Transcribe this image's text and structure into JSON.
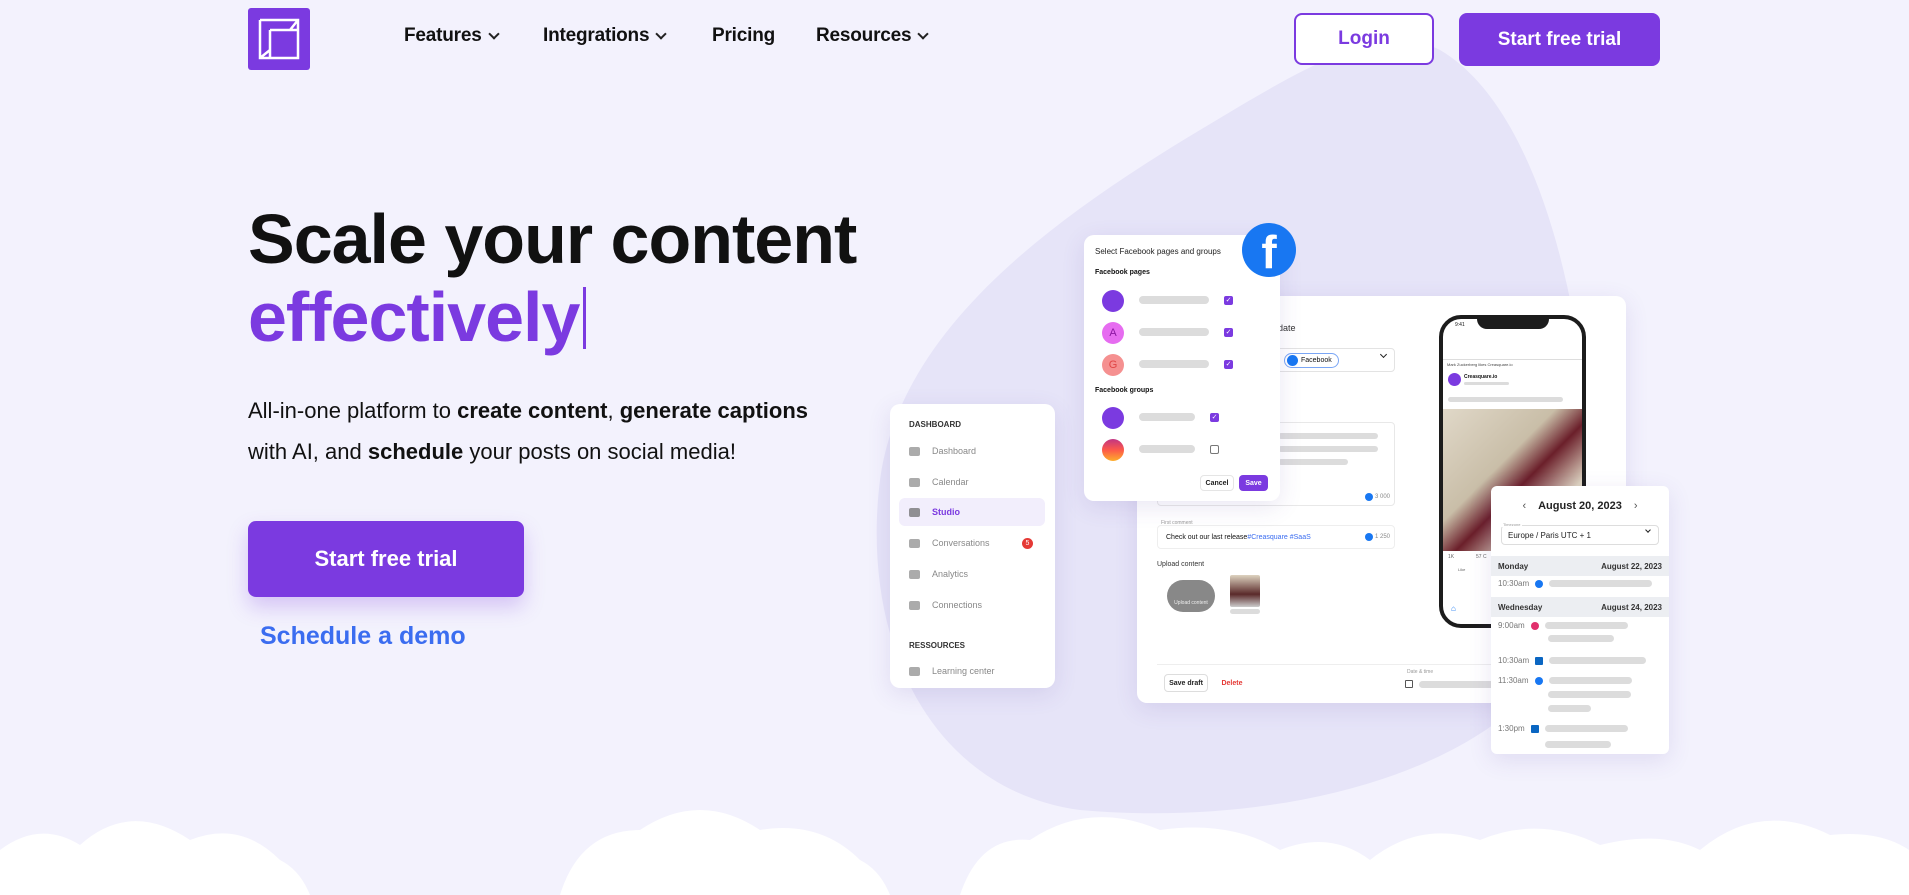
{
  "nav": {
    "items": [
      {
        "label": "Features",
        "dropdown": true
      },
      {
        "label": "Integrations",
        "dropdown": true
      },
      {
        "label": "Pricing",
        "dropdown": false
      },
      {
        "label": "Resources",
        "dropdown": true
      }
    ],
    "login": "Login",
    "start_trial": "Start free trial"
  },
  "hero": {
    "title_line1": "Scale your content",
    "title_line2": "effectively",
    "para": {
      "p1": "All-in-one platform to ",
      "b1": "create content",
      ",": ", ",
      "b2": "generate captions",
      "p2": "with AI, and ",
      "b3": "schedule",
      "p3": " your posts on social media!"
    },
    "cta": "Start free trial",
    "demo": "Schedule a demo"
  },
  "colors": {
    "brand": "#7b3ae0",
    "link": "#3b6df0",
    "background": "#f3f2fd",
    "facebook": "#1877f2"
  },
  "sidebar": {
    "section1": "DASHBOARD",
    "items": [
      {
        "label": "Dashboard",
        "icon": "gauge-icon"
      },
      {
        "label": "Calendar",
        "icon": "calendar-icon"
      },
      {
        "label": "Studio",
        "icon": "video-icon",
        "active": true
      },
      {
        "label": "Conversations",
        "icon": "chat-icon",
        "badge": "5"
      },
      {
        "label": "Analytics",
        "icon": "chart-icon"
      },
      {
        "label": "Connections",
        "icon": "sliders-icon"
      }
    ],
    "section2": "RESSOURCES",
    "items2": [
      {
        "label": "Learning center",
        "icon": "shapes-icon"
      }
    ]
  },
  "popup": {
    "title": "Select Facebook pages and groups",
    "pages_label": "Facebook pages",
    "groups_label": "Facebook groups",
    "pages": [
      {
        "avatar": "logo",
        "checked": true
      },
      {
        "avatar": "A",
        "checked": true
      },
      {
        "avatar": "G",
        "checked": true
      }
    ],
    "groups": [
      {
        "avatar": "logo",
        "checked": true
      },
      {
        "avatar": "instagram",
        "checked": false
      }
    ],
    "cancel": "Cancel",
    "save": "Save"
  },
  "studio": {
    "date_label": "date",
    "channel_chip": "Facebook",
    "counter1": "3 000",
    "first_comment_label": "First comment",
    "first_comment": "Check out our last release ",
    "hashtags": "#Creasquare #SaaS",
    "counter2": "1 250",
    "upload_label": "Upload content",
    "upload_button": "Upload content",
    "save_draft": "Save draft",
    "delete": "Delete",
    "date_time_label": "Date & time"
  },
  "phone": {
    "time": "9:41",
    "post_header": "Mark Zuckerberg likes Creasquare.io",
    "page_name": "Creasquare.io",
    "reactions": "1K",
    "comments": "57 C",
    "like": "Like"
  },
  "calendar": {
    "date": "August 20, 2023",
    "timezone_label": "Timezone",
    "timezone": "Europe / Paris UTC + 1",
    "days": [
      {
        "day": "Monday",
        "date": "August 22, 2023",
        "slots": [
          {
            "time": "10:30am",
            "network": "facebook"
          }
        ]
      },
      {
        "day": "Wednesday",
        "date": "August 24, 2023",
        "slots": [
          {
            "time": "9:00am",
            "network": "instagram"
          },
          {
            "time": "10:30am",
            "network": "linkedin"
          },
          {
            "time": "11:30am",
            "network": "facebook"
          },
          {
            "time": "1:30pm",
            "network": "linkedin"
          }
        ]
      }
    ]
  }
}
